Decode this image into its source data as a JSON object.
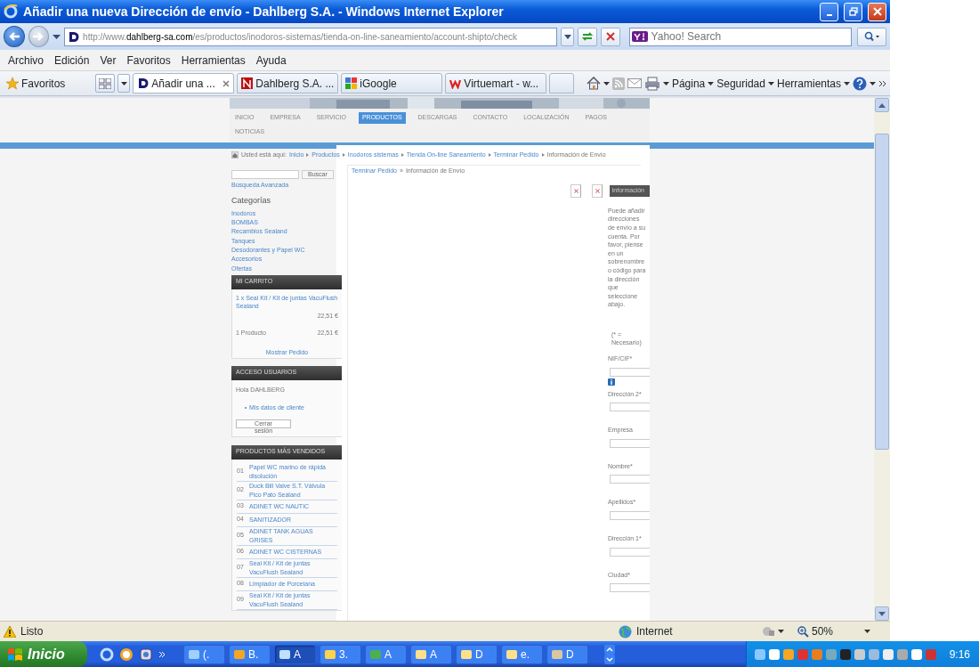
{
  "window": {
    "title": "Añadir una nueva Dirección de envío - Dahlberg S.A. - Windows Internet Explorer"
  },
  "address_bar": {
    "url_prefix": "http://www.",
    "url_domain": "dahlberg-sa.com",
    "url_path": "/es/productos/inodoros-sistemas/tienda-on-line-saneamiento/account-shipto/check"
  },
  "search": {
    "placeholder": "Yahoo! Search"
  },
  "menu": [
    "Archivo",
    "Edición",
    "Ver",
    "Favoritos",
    "Herramientas",
    "Ayuda"
  ],
  "favorites_bar": {
    "label": "Favoritos",
    "tabs": [
      {
        "label": "Añadir una ...",
        "selected": true
      },
      {
        "label": "Dahlberg S.A. ...",
        "selected": false
      },
      {
        "label": "iGoogle",
        "selected": false
      },
      {
        "label": "Virtuemart - w...",
        "selected": false
      }
    ],
    "commands": [
      "Página",
      "Seguridad",
      "Herramientas"
    ]
  },
  "site": {
    "nav": [
      {
        "label": "INICIO",
        "selected": false
      },
      {
        "label": "EMPRESA",
        "selected": false
      },
      {
        "label": "SERVICIO",
        "selected": false
      },
      {
        "label": "PRODUCTOS",
        "selected": true
      },
      {
        "label": "DESCARGAS",
        "selected": false
      },
      {
        "label": "CONTACTO",
        "selected": false
      },
      {
        "label": "LOCALIZACIÓN",
        "selected": false
      },
      {
        "label": "PAGOS",
        "selected": false
      },
      {
        "label": "NOTICIAS",
        "selected": false
      }
    ],
    "breadcrumb": {
      "label": "Usted está aquí:",
      "items": [
        "Inicio",
        "Productos",
        "Inodoros sistemas",
        "Tienda On-line Saneamiento",
        "Terminar Pedido"
      ],
      "current": "Información de Envío"
    },
    "search_button": "Buscar",
    "advanced_search": "Búsqueda Avanzada",
    "categories": {
      "title": "Categorías",
      "items": [
        "Inodoros",
        "BOMBAS",
        "Recambios Sealand",
        "Tanques",
        "Desodorantes y Papel WC",
        "Accesorios",
        "Ofertas"
      ]
    },
    "cart": {
      "title": "MI CARRITO",
      "item": "1 x Seal Kit / Kit de juntas VacuFlush Sealand",
      "item_price": "22,51 €",
      "count": "1 Producto",
      "total": "22,51 €",
      "show_order": "Mostrar Pedido"
    },
    "login": {
      "title": "ACCESO USUARIOS",
      "greeting": "Hola DAHLBERG",
      "link": "Mis datos de cliente",
      "logout": "Cerrar sesión"
    },
    "best_sellers": {
      "title": "PRODUCTOS MÁS VENDIDOS",
      "items": [
        {
          "rank": "01",
          "name": "Papel WC marino de rápida disolución"
        },
        {
          "rank": "02",
          "name": "Duck Bill Valve S.T. Válvula Pico Pato Sealand"
        },
        {
          "rank": "03",
          "name": "ADINET WC NAUTIC"
        },
        {
          "rank": "04",
          "name": "SANITIZADOR"
        },
        {
          "rank": "05",
          "name": "ADINET TANK AGUAS GRISES"
        },
        {
          "rank": "06",
          "name": "ADINET WC CISTERNAS"
        },
        {
          "rank": "07",
          "name": "Seal Kit / Kit de juntas VacuFlush Sealand"
        },
        {
          "rank": "08",
          "name": "Limpiador de Porcelana"
        },
        {
          "rank": "09",
          "name": "Seal Kit / Kit de juntas VacuFlush Sealand"
        }
      ]
    },
    "main": {
      "back_link": "Terminar Pedido",
      "separator": "»",
      "heading": "Información de Envío",
      "tab_label": "Información",
      "intro": "Puede añadir direcciones de envío a su cuenta. Por favor, piense en un sobrenombre o código para la dirección que seleccione abajo.",
      "required_note": "(* = Necesario)",
      "fields": [
        {
          "label": "NIF/CIF*",
          "info": true
        },
        {
          "label": "Dirección 2*",
          "info": false
        },
        {
          "label": "Empresa",
          "info": false
        },
        {
          "label": "Nombre*",
          "info": false
        },
        {
          "label": "Apellidos*",
          "info": false
        },
        {
          "label": "Dirección 1*",
          "info": false
        },
        {
          "label": "Ciudad*",
          "info": false
        }
      ]
    }
  },
  "status_bar": {
    "text": "Listo",
    "zone": "Internet",
    "zoom": "50%"
  },
  "taskbar": {
    "start": "Inicio",
    "tasks": [
      {
        "label": "(.",
        "selected": false
      },
      {
        "label": "B.",
        "selected": false
      },
      {
        "label": "A",
        "selected": true
      },
      {
        "label": "3.",
        "selected": false
      },
      {
        "label": "A",
        "selected": false
      },
      {
        "label": "A",
        "selected": false
      },
      {
        "label": "D",
        "selected": false
      },
      {
        "label": "e.",
        "selected": false
      },
      {
        "label": "D",
        "selected": false
      }
    ],
    "clock": "9:16"
  }
}
